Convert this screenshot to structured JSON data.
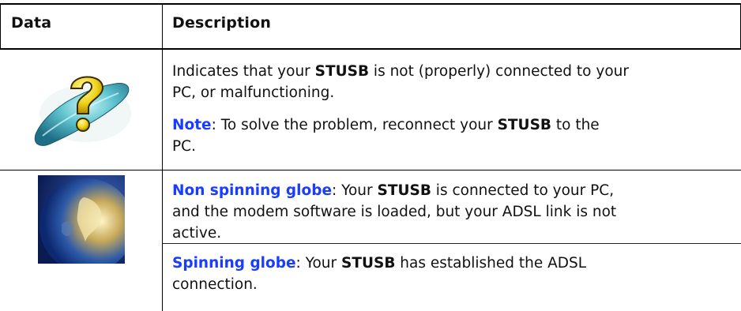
{
  "table": {
    "headers": [
      "Data",
      "Description"
    ],
    "rows": [
      {
        "icon": "modem-question-icon",
        "paragraph1": {
          "before": "Indicates that your ",
          "bold": "STUSB",
          "after": " is not (properly) connected to your",
          "line2": "PC, or malfunctioning."
        },
        "paragraph2": {
          "label": "Note",
          "text": ": To solve the problem, reconnect your ",
          "bold": "STUSB",
          "after": " to the",
          "line2": "PC."
        }
      },
      {
        "icon": "globe-icon",
        "entries": [
          {
            "label": "Non spinning globe",
            "text": ": Your ",
            "bold": "STUSB",
            "after": " is connected to your PC,",
            "line2": "and the modem software is loaded, but your ADSL link is not",
            "line3": "active."
          },
          {
            "label": "Spinning globe",
            "text": ": Your ",
            "bold": "STUSB",
            "after": " has established the ADSL",
            "line2": "connection."
          }
        ]
      }
    ]
  },
  "colors": {
    "link_blue": "#1a3cff",
    "rule": "#000000"
  }
}
